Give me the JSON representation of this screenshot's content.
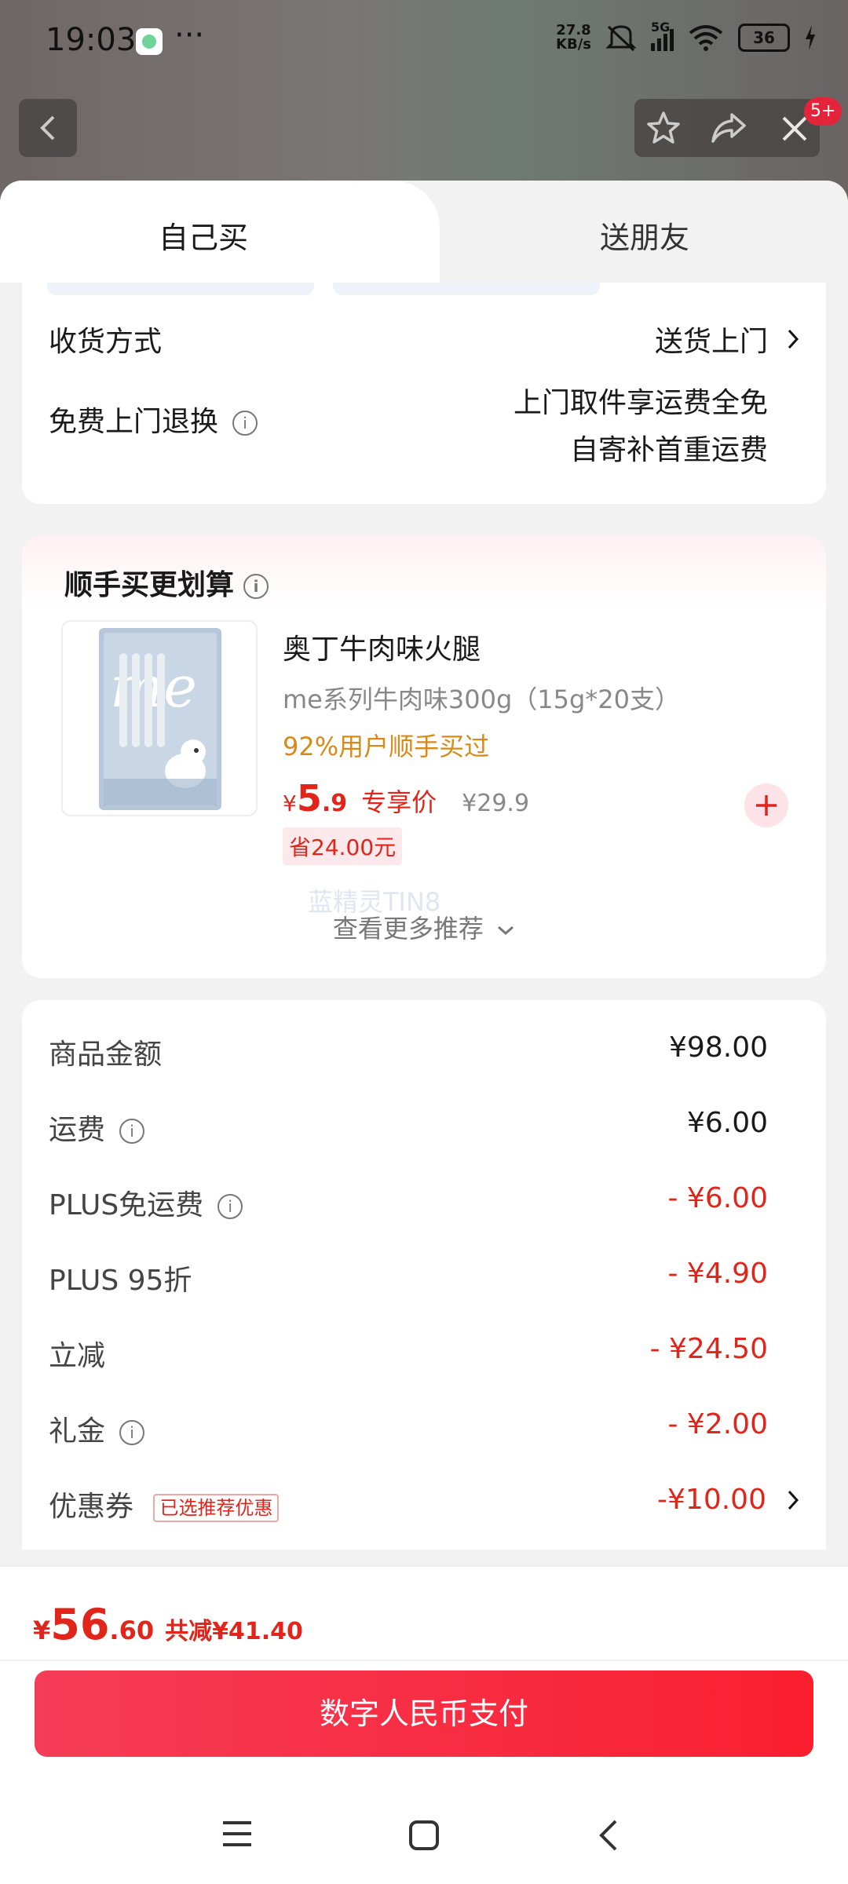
{
  "status": {
    "time": "19:03",
    "speed_top": "27.8",
    "speed_unit": "KB/s",
    "network": "5G",
    "battery": "36"
  },
  "header": {
    "badge": "5+"
  },
  "tabs": [
    {
      "label": "自己买",
      "active": true
    },
    {
      "label": "送朋友",
      "active": false
    }
  ],
  "delivery": {
    "method_label": "收货方式",
    "method_value": "送货上门",
    "return_label": "免费上门退换",
    "return_line1": "上门取件享运费全免",
    "return_line2": "自寄补首重运费"
  },
  "addon": {
    "title": "顺手买更划算",
    "product": {
      "name": "奥丁牛肉味火腿",
      "spec": "me系列牛肉味300g（15g*20支）",
      "bought": "92%用户顺手买过",
      "currency": "¥",
      "price_int": "5",
      "price_dec": ".9",
      "price_tag": "专享价",
      "orig_price": "¥29.9",
      "save": "省24.00元"
    },
    "watermark": "蓝精灵TIN8",
    "more": "查看更多推荐"
  },
  "summary": {
    "rows": [
      {
        "label": "商品金额",
        "value": "¥98.00",
        "info": false,
        "red": false
      },
      {
        "label": "运费",
        "value": "¥6.00",
        "info": true,
        "red": false
      },
      {
        "label": "PLUS免运费",
        "value": "- ¥6.00",
        "info": true,
        "red": true
      },
      {
        "label": "PLUS 95折",
        "value": "- ¥4.90",
        "info": false,
        "red": true
      },
      {
        "label": "立减",
        "value": "- ¥24.50",
        "info": false,
        "red": true
      },
      {
        "label": "礼金",
        "value": "- ¥2.00",
        "info": true,
        "red": true
      },
      {
        "label": "优惠券",
        "value": "-¥10.00",
        "info": false,
        "red": true,
        "tag": "已选推荐优惠"
      }
    ]
  },
  "footer": {
    "currency": "¥",
    "total_int": "56",
    "total_dec": ".60",
    "discount": "共减¥41.40",
    "pay_button": "数字人民币支付"
  },
  "colors": {
    "accent": "#e1251b",
    "button": "#f7263d"
  }
}
